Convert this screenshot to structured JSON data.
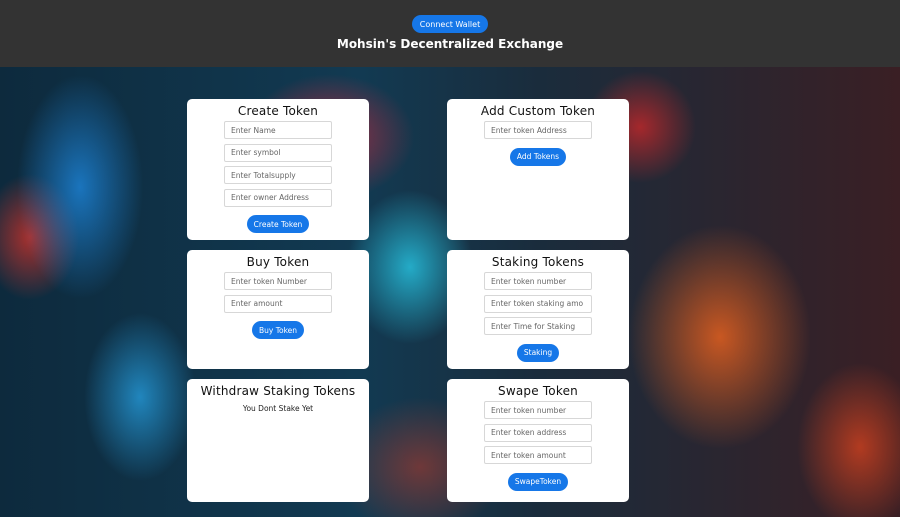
{
  "header": {
    "connect_label": "Connect Wallet",
    "title": "Mohsin's Decentralized Exchange"
  },
  "colors": {
    "header_bg": "#333333",
    "accent": "#1677e8",
    "card_bg": "#ffffff"
  },
  "create_token": {
    "title": "Create Token",
    "name_placeholder": "Enter Name",
    "symbol_placeholder": "Enter symbol",
    "supply_placeholder": "Enter Totalsupply",
    "owner_placeholder": "Enter owner Address",
    "button_label": "Create Token"
  },
  "custom_token": {
    "title": "Add Custom Token",
    "address_placeholder": "Enter token Address",
    "button_label": "Add Tokens"
  },
  "buy_token": {
    "title": "Buy Token",
    "number_placeholder": "Enter token Number",
    "amount_placeholder": "Enter amount",
    "button_label": "Buy Token"
  },
  "staking": {
    "title": "Staking Tokens",
    "number_placeholder": "Enter token number",
    "amount_placeholder": "Enter token staking amo",
    "time_placeholder": "Enter Time for Staking",
    "button_label": "Staking"
  },
  "withdraw": {
    "title": "Withdraw Staking Tokens",
    "status": "You Dont Stake Yet"
  },
  "swap": {
    "title": "Swape Token",
    "number_placeholder": "Enter token number",
    "address_placeholder": "Enter token address",
    "amount_placeholder": "Enter token amount",
    "button_label": "SwapeToken"
  }
}
